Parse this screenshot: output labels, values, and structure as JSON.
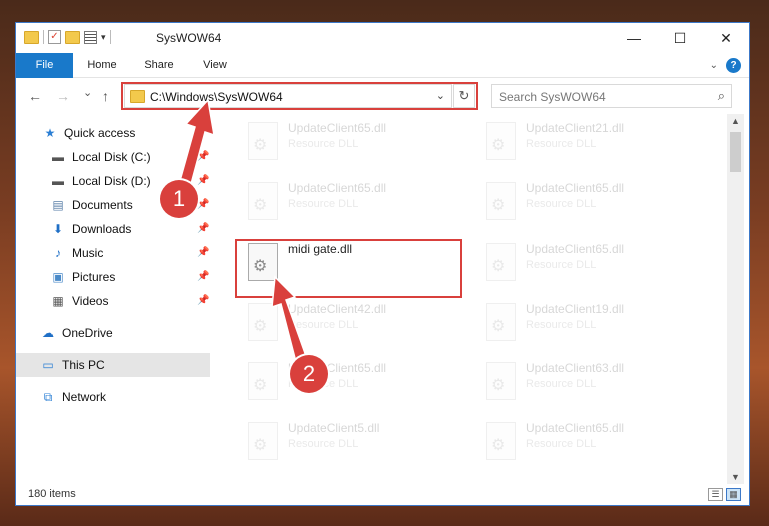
{
  "window": {
    "title": "SysWOW64",
    "minimize": "—",
    "maximize": "☐",
    "close": "✕"
  },
  "ribbon": {
    "tabs": [
      "File",
      "Home",
      "Share",
      "View"
    ],
    "help": "?"
  },
  "nav": {
    "back": "←",
    "forward": "→",
    "recent": "⌄",
    "up": "↑",
    "address": "C:\\Windows\\SysWOW64",
    "refresh": "↻",
    "search_placeholder": "Search SysWOW64"
  },
  "sidebar": {
    "items": [
      {
        "label": "Quick access",
        "icon": "star-icon",
        "glyph": "★",
        "color": "#2b7fd4",
        "pinned": false
      },
      {
        "label": "Local Disk (C:)",
        "icon": "drive-icon",
        "glyph": "▬",
        "color": "#555",
        "pinned": true
      },
      {
        "label": "Local Disk (D:)",
        "icon": "drive-icon",
        "glyph": "▬",
        "color": "#555",
        "pinned": true
      },
      {
        "label": "Documents",
        "icon": "documents-icon",
        "glyph": "▤",
        "color": "#5a7fa8",
        "pinned": true
      },
      {
        "label": "Downloads",
        "icon": "download-icon",
        "glyph": "⬇",
        "color": "#1f6fc6",
        "pinned": true
      },
      {
        "label": "Music",
        "icon": "music-icon",
        "glyph": "♪",
        "color": "#1f6fc6",
        "pinned": true
      },
      {
        "label": "Pictures",
        "icon": "pictures-icon",
        "glyph": "▣",
        "color": "#4a8ac8",
        "pinned": true
      },
      {
        "label": "Videos",
        "icon": "videos-icon",
        "glyph": "▦",
        "color": "#555",
        "pinned": true
      },
      {
        "label": "OneDrive",
        "icon": "cloud-icon",
        "glyph": "☁",
        "color": "#1f6fc6",
        "pinned": false
      },
      {
        "label": "This PC",
        "icon": "computer-icon",
        "glyph": "▭",
        "color": "#2b7fd4",
        "pinned": false
      },
      {
        "label": "Network",
        "icon": "network-icon",
        "glyph": "⧉",
        "color": "#2b7fd4",
        "pinned": false
      }
    ],
    "pin_glyph": "📌"
  },
  "files": {
    "left": [
      {
        "name": "UpdateClient65.dll",
        "type": "Resource DLL",
        "faded": true
      },
      {
        "name": "UpdateClient65.dll",
        "type": "Resource DLL",
        "faded": true
      },
      {
        "name": "midi gate.dll",
        "type": "",
        "faded": false
      },
      {
        "name": "UpdateClient42.dll",
        "type": "Resource DLL",
        "faded": true
      },
      {
        "name": "UpdateClient65.dll",
        "type": "Resource DLL",
        "faded": true
      },
      {
        "name": "UpdateClient5.dll",
        "type": "Resource DLL",
        "faded": true
      }
    ],
    "right": [
      {
        "name": "UpdateClient21.dll",
        "type": "Resource DLL",
        "faded": true
      },
      {
        "name": "UpdateClient65.dll",
        "type": "Resource DLL",
        "faded": true
      },
      {
        "name": "UpdateClient65.dll",
        "type": "Resource DLL",
        "faded": true
      },
      {
        "name": "UpdateClient19.dll",
        "type": "Resource DLL",
        "faded": true
      },
      {
        "name": "UpdateClient63.dll",
        "type": "Resource DLL",
        "faded": true
      },
      {
        "name": "UpdateClient65.dll",
        "type": "Resource DLL",
        "faded": true
      }
    ]
  },
  "status": {
    "item_count": "180 items"
  },
  "annotations": {
    "step1": "1",
    "step2": "2",
    "highlight_color": "#d9403c"
  }
}
